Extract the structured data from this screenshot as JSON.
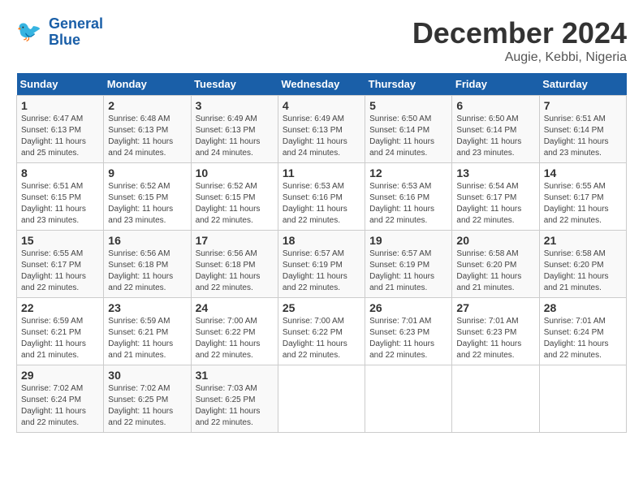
{
  "header": {
    "logo_line1": "General",
    "logo_line2": "Blue",
    "month": "December 2024",
    "location": "Augie, Kebbi, Nigeria"
  },
  "weekdays": [
    "Sunday",
    "Monday",
    "Tuesday",
    "Wednesday",
    "Thursday",
    "Friday",
    "Saturday"
  ],
  "weeks": [
    [
      {
        "day": "1",
        "info": "Sunrise: 6:47 AM\nSunset: 6:13 PM\nDaylight: 11 hours\nand 25 minutes."
      },
      {
        "day": "2",
        "info": "Sunrise: 6:48 AM\nSunset: 6:13 PM\nDaylight: 11 hours\nand 24 minutes."
      },
      {
        "day": "3",
        "info": "Sunrise: 6:49 AM\nSunset: 6:13 PM\nDaylight: 11 hours\nand 24 minutes."
      },
      {
        "day": "4",
        "info": "Sunrise: 6:49 AM\nSunset: 6:13 PM\nDaylight: 11 hours\nand 24 minutes."
      },
      {
        "day": "5",
        "info": "Sunrise: 6:50 AM\nSunset: 6:14 PM\nDaylight: 11 hours\nand 24 minutes."
      },
      {
        "day": "6",
        "info": "Sunrise: 6:50 AM\nSunset: 6:14 PM\nDaylight: 11 hours\nand 23 minutes."
      },
      {
        "day": "7",
        "info": "Sunrise: 6:51 AM\nSunset: 6:14 PM\nDaylight: 11 hours\nand 23 minutes."
      }
    ],
    [
      {
        "day": "8",
        "info": "Sunrise: 6:51 AM\nSunset: 6:15 PM\nDaylight: 11 hours\nand 23 minutes."
      },
      {
        "day": "9",
        "info": "Sunrise: 6:52 AM\nSunset: 6:15 PM\nDaylight: 11 hours\nand 23 minutes."
      },
      {
        "day": "10",
        "info": "Sunrise: 6:52 AM\nSunset: 6:15 PM\nDaylight: 11 hours\nand 22 minutes."
      },
      {
        "day": "11",
        "info": "Sunrise: 6:53 AM\nSunset: 6:16 PM\nDaylight: 11 hours\nand 22 minutes."
      },
      {
        "day": "12",
        "info": "Sunrise: 6:53 AM\nSunset: 6:16 PM\nDaylight: 11 hours\nand 22 minutes."
      },
      {
        "day": "13",
        "info": "Sunrise: 6:54 AM\nSunset: 6:17 PM\nDaylight: 11 hours\nand 22 minutes."
      },
      {
        "day": "14",
        "info": "Sunrise: 6:55 AM\nSunset: 6:17 PM\nDaylight: 11 hours\nand 22 minutes."
      }
    ],
    [
      {
        "day": "15",
        "info": "Sunrise: 6:55 AM\nSunset: 6:17 PM\nDaylight: 11 hours\nand 22 minutes."
      },
      {
        "day": "16",
        "info": "Sunrise: 6:56 AM\nSunset: 6:18 PM\nDaylight: 11 hours\nand 22 minutes."
      },
      {
        "day": "17",
        "info": "Sunrise: 6:56 AM\nSunset: 6:18 PM\nDaylight: 11 hours\nand 22 minutes."
      },
      {
        "day": "18",
        "info": "Sunrise: 6:57 AM\nSunset: 6:19 PM\nDaylight: 11 hours\nand 22 minutes."
      },
      {
        "day": "19",
        "info": "Sunrise: 6:57 AM\nSunset: 6:19 PM\nDaylight: 11 hours\nand 21 minutes."
      },
      {
        "day": "20",
        "info": "Sunrise: 6:58 AM\nSunset: 6:20 PM\nDaylight: 11 hours\nand 21 minutes."
      },
      {
        "day": "21",
        "info": "Sunrise: 6:58 AM\nSunset: 6:20 PM\nDaylight: 11 hours\nand 21 minutes."
      }
    ],
    [
      {
        "day": "22",
        "info": "Sunrise: 6:59 AM\nSunset: 6:21 PM\nDaylight: 11 hours\nand 21 minutes."
      },
      {
        "day": "23",
        "info": "Sunrise: 6:59 AM\nSunset: 6:21 PM\nDaylight: 11 hours\nand 21 minutes."
      },
      {
        "day": "24",
        "info": "Sunrise: 7:00 AM\nSunset: 6:22 PM\nDaylight: 11 hours\nand 22 minutes."
      },
      {
        "day": "25",
        "info": "Sunrise: 7:00 AM\nSunset: 6:22 PM\nDaylight: 11 hours\nand 22 minutes."
      },
      {
        "day": "26",
        "info": "Sunrise: 7:01 AM\nSunset: 6:23 PM\nDaylight: 11 hours\nand 22 minutes."
      },
      {
        "day": "27",
        "info": "Sunrise: 7:01 AM\nSunset: 6:23 PM\nDaylight: 11 hours\nand 22 minutes."
      },
      {
        "day": "28",
        "info": "Sunrise: 7:01 AM\nSunset: 6:24 PM\nDaylight: 11 hours\nand 22 minutes."
      }
    ],
    [
      {
        "day": "29",
        "info": "Sunrise: 7:02 AM\nSunset: 6:24 PM\nDaylight: 11 hours\nand 22 minutes."
      },
      {
        "day": "30",
        "info": "Sunrise: 7:02 AM\nSunset: 6:25 PM\nDaylight: 11 hours\nand 22 minutes."
      },
      {
        "day": "31",
        "info": "Sunrise: 7:03 AM\nSunset: 6:25 PM\nDaylight: 11 hours\nand 22 minutes."
      },
      {
        "day": "",
        "info": ""
      },
      {
        "day": "",
        "info": ""
      },
      {
        "day": "",
        "info": ""
      },
      {
        "day": "",
        "info": ""
      }
    ]
  ]
}
